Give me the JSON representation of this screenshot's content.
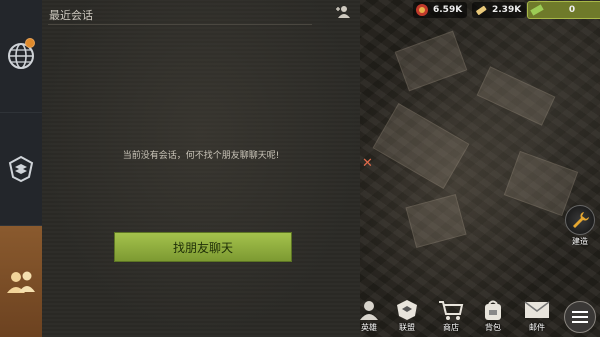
{
  "chat": {
    "title": "最近会话",
    "empty_message": "当前没有会话，何不找个朋友聊聊天呢!",
    "find_friend_button": "找朋友聊天"
  },
  "resources": [
    {
      "icon": "food-icon",
      "value": "6.59K"
    },
    {
      "icon": "ammo-icon",
      "value": "2.39K"
    },
    {
      "icon": "cash-icon",
      "value": "0"
    }
  ],
  "build": {
    "label": "建造",
    "icon": "wrench-icon"
  },
  "bottom_nav": [
    {
      "label": "英雄",
      "icon": "hero-icon"
    },
    {
      "label": "联盟",
      "icon": "alliance-icon"
    },
    {
      "label": "商店",
      "icon": "shop-icon"
    },
    {
      "label": "背包",
      "icon": "backpack-icon"
    },
    {
      "label": "邮件",
      "icon": "mail-icon"
    }
  ],
  "colors": {
    "button_green": "#8fae3c",
    "tab_active": "#7a4e27",
    "notify": "#e08a2c"
  }
}
